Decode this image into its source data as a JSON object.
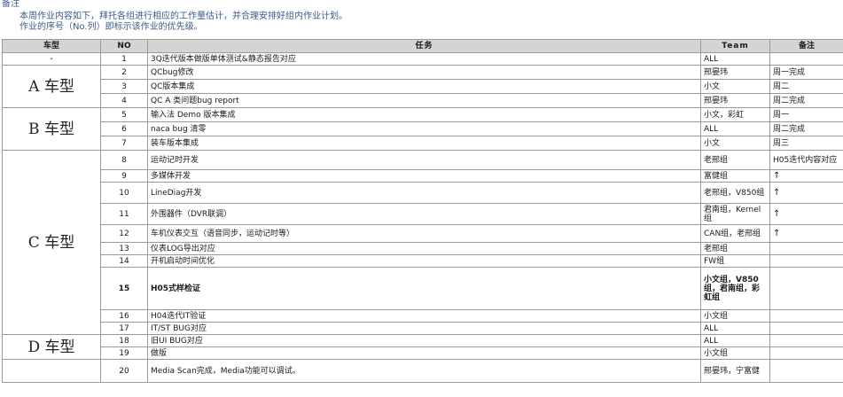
{
  "note": {
    "title": "备注",
    "lines": [
      "本周作业内容如下，拜托各组进行相应的工作量估计，并合理安排好组内作业计划。",
      "作业的序号（No.列）即标示该作业的优先级。"
    ]
  },
  "table": {
    "headers": [
      "车型",
      "NO",
      "任务",
      "Team",
      "备注"
    ],
    "groups": {
      "dash": "-",
      "A": "A 车型",
      "B": "B 车型",
      "C": "C 车型",
      "D": "D 车型"
    },
    "rows": [
      {
        "no": "1",
        "task": "3Q迭代版本做版单体测试&静态报告对应",
        "team": "ALL",
        "note": ""
      },
      {
        "no": "2",
        "task": "QCbug修改",
        "team": "邢晏玮",
        "note": "周一完成"
      },
      {
        "no": "3",
        "task": "QC版本集成",
        "team": "小文",
        "note": "周二"
      },
      {
        "no": "4",
        "task": "QC A 类问题bug report",
        "team": "邢晏玮",
        "note": "周二完成"
      },
      {
        "no": "5",
        "task": "输入法 Demo 版本集成",
        "team": "小文，彩虹",
        "note": "周一"
      },
      {
        "no": "6",
        "task": "naca bug 清零",
        "team": "ALL",
        "note": "周二完成"
      },
      {
        "no": "7",
        "task": "装车版本集成",
        "team": "小文",
        "note": "周三"
      },
      {
        "no": "8",
        "task": "运动记时开发",
        "team": "老邢组",
        "note": "H05迭代内容对应"
      },
      {
        "no": "9",
        "task": "多媒体开发",
        "team": "富健组",
        "note": "↑"
      },
      {
        "no": "10",
        "task": "LineDiag开发",
        "team": "老邢组，V850组",
        "note": "↑"
      },
      {
        "no": "11",
        "task": "外围器件（DVR联调）",
        "team": "君南组，Kernel组",
        "note": "↑"
      },
      {
        "no": "12",
        "task": "车机仪表交互（语音同步，运动记时等）",
        "team": "CAN组，老邢组",
        "note": "↑"
      },
      {
        "no": "13",
        "task": "仪表LOG导出对应",
        "team": "老邢组",
        "note": ""
      },
      {
        "no": "14",
        "task": "开机启动时间优化",
        "team": "FW组",
        "note": ""
      },
      {
        "no": "15",
        "task": "H05式样检证",
        "team": "小文组，V850组，君南组，彩虹组",
        "note": ""
      },
      {
        "no": "16",
        "task": "H04迭代IT验证",
        "team": "小文组",
        "note": ""
      },
      {
        "no": "17",
        "task": "IT/ST BUG对应",
        "team": "ALL",
        "note": ""
      },
      {
        "no": "18",
        "task": "旧UI BUG对应",
        "team": "ALL",
        "note": ""
      },
      {
        "no": "19",
        "task": "做版",
        "team": "小文组",
        "note": ""
      },
      {
        "no": "20",
        "task": "Media Scan完成，Media功能可以调试。",
        "team": "邢晏玮，宁富健",
        "note": ""
      }
    ]
  }
}
